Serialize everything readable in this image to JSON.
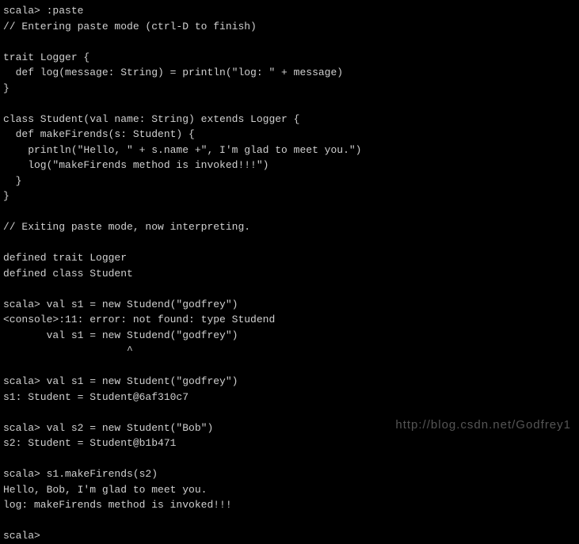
{
  "lines": [
    "scala> :paste",
    "// Entering paste mode (ctrl-D to finish)",
    "",
    "trait Logger {",
    "  def log(message: String) = println(\"log: \" + message)",
    "}",
    "",
    "class Student(val name: String) extends Logger {",
    "  def makeFirends(s: Student) {",
    "    println(\"Hello, \" + s.name +\", I'm glad to meet you.\")",
    "    log(\"makeFirends method is invoked!!!\")",
    "  }",
    "}",
    "",
    "// Exiting paste mode, now interpreting.",
    "",
    "defined trait Logger",
    "defined class Student",
    "",
    "scala> val s1 = new Studend(\"godfrey\")",
    "<console>:11: error: not found: type Studend",
    "       val s1 = new Studend(\"godfrey\")",
    "                    ^",
    "",
    "scala> val s1 = new Student(\"godfrey\")",
    "s1: Student = Student@6af310c7",
    "",
    "scala> val s2 = new Student(\"Bob\")",
    "s2: Student = Student@b1b471",
    "",
    "scala> s1.makeFirends(s2)",
    "Hello, Bob, I'm glad to meet you.",
    "log: makeFirends method is invoked!!!",
    "",
    "scala>"
  ],
  "watermark": "http://blog.csdn.net/Godfrey1"
}
